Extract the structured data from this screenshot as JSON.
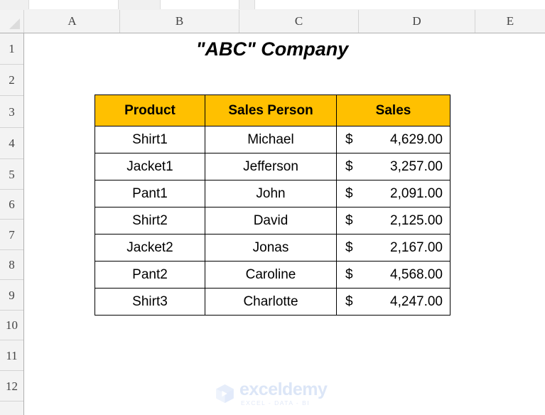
{
  "app": {
    "name": "Microsoft Excel",
    "gridlines_visible": false
  },
  "grid": {
    "column_headers": [
      "A",
      "B",
      "C",
      "D",
      "E"
    ],
    "row_headers": [
      "1",
      "2",
      "3",
      "4",
      "5",
      "6",
      "7",
      "8",
      "9",
      "10",
      "11",
      "12"
    ],
    "select_all_icon": "select-all-triangle-icon"
  },
  "sheet": {
    "title": "\"ABC\" Company",
    "title_cell": "B2"
  },
  "table": {
    "header_fill": "#FFC000",
    "border_color": "#000000",
    "columns": [
      "Product",
      "Sales Person",
      "Sales"
    ],
    "rows": [
      {
        "product": "Shirt1",
        "person": "Michael",
        "currency": "$",
        "amount": "4,629.00"
      },
      {
        "product": "Jacket1",
        "person": "Jefferson",
        "currency": "$",
        "amount": "3,257.00"
      },
      {
        "product": "Pant1",
        "person": "John",
        "currency": "$",
        "amount": "2,091.00"
      },
      {
        "product": "Shirt2",
        "person": "David",
        "currency": "$",
        "amount": "2,125.00"
      },
      {
        "product": "Jacket2",
        "person": "Jonas",
        "currency": "$",
        "amount": "2,167.00"
      },
      {
        "product": "Pant2",
        "person": "Caroline",
        "currency": "$",
        "amount": "4,568.00"
      },
      {
        "product": "Shirt3",
        "person": "Charlotte",
        "currency": "$",
        "amount": "4,247.00"
      }
    ]
  },
  "watermark": {
    "name": "exceldemy",
    "tagline": "EXCEL - DATA - BI",
    "color": "#dce6f7"
  }
}
